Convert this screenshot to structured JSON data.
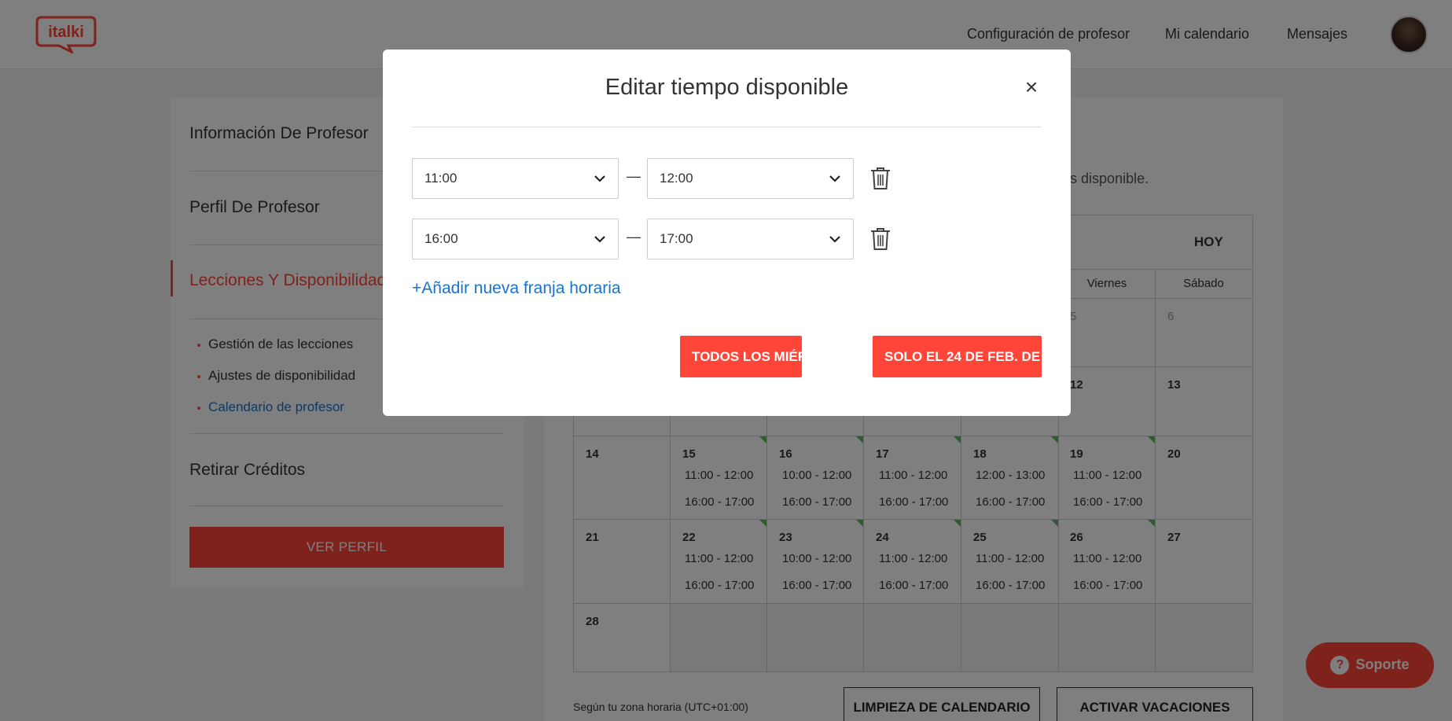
{
  "header": {
    "nav": [
      "Configuración de profesor",
      "Mi calendario",
      "Mensajes"
    ]
  },
  "sidebar": {
    "items": [
      "Información De Profesor",
      "Perfil De Profesor",
      "Lecciones Y Disponibilidad",
      "Retirar Créditos"
    ],
    "subitems": [
      "Gestión de las lecciones",
      "Ajustes de disponibilidad",
      "Calendario de profesor"
    ],
    "view_button": "VER PERFIL"
  },
  "main": {
    "intro_fragment": "e estás disponible.",
    "today": "HOY",
    "day_headers": [
      "Viernes",
      "Sábado"
    ],
    "row1": [
      "5",
      "6"
    ],
    "row2": [
      "12",
      "13"
    ],
    "row3": {
      "dates": [
        "14",
        "15",
        "16",
        "17",
        "18",
        "19",
        "20"
      ],
      "slots": [
        [
          "11:00 - 12:00",
          "16:00 - 17:00"
        ],
        [
          "10:00 - 12:00",
          "16:00 - 17:00"
        ],
        [
          "11:00 - 12:00",
          "16:00 - 17:00"
        ],
        [
          "12:00 - 13:00",
          "16:00 - 17:00"
        ],
        [
          "11:00 - 12:00",
          "16:00 - 17:00"
        ]
      ]
    },
    "row4": {
      "dates": [
        "21",
        "22",
        "23",
        "24",
        "25",
        "26",
        "27"
      ],
      "slots": [
        [
          "11:00 - 12:00",
          "16:00 - 17:00"
        ],
        [
          "10:00 - 12:00",
          "16:00 - 17:00"
        ],
        [
          "11:00 - 12:00",
          "16:00 - 17:00"
        ],
        [
          "11:00 - 12:00",
          "16:00 - 17:00"
        ],
        [
          "11:00 - 12:00",
          "16:00 - 17:00"
        ]
      ]
    },
    "row5": [
      "28"
    ],
    "timezone": "Según tu zona horaria (UTC+01:00)",
    "clear_button": "LIMPIEZA DE CALENDARIO",
    "vacation_button": "ACTIVAR VACACIONES"
  },
  "support": {
    "label": "Soporte",
    "icon_char": "?"
  },
  "modal": {
    "title": "Editar tiempo disponible",
    "close_char": "×",
    "ranges": [
      {
        "start": "11:00",
        "end": "12:00"
      },
      {
        "start": "16:00",
        "end": "17:00"
      }
    ],
    "dash": "—",
    "add_label": "+Añadir nueva franja horaria",
    "every_button": "TODOS LOS MIÉRCOLES",
    "only_button": "SOLO EL 24 DE FEB. DE"
  },
  "colors": {
    "accent": "#ff4438",
    "link": "#1a73c9",
    "slot_marker": "#5cb85c"
  }
}
